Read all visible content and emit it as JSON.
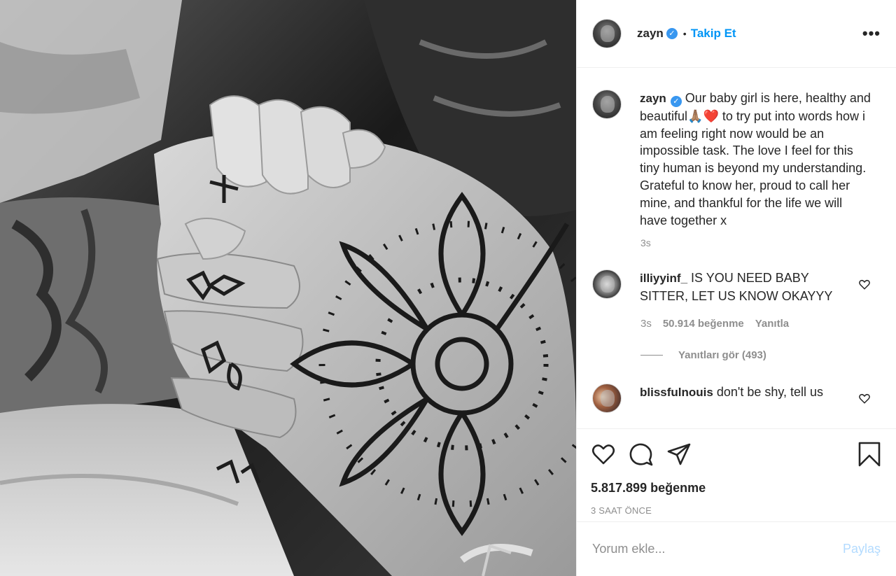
{
  "post": {
    "author": "zayn",
    "follow_label": "Takip Et",
    "separator": "•",
    "more_label": "•••"
  },
  "caption": {
    "username": "zayn",
    "text": "Our baby girl is here, healthy and beautiful🙏🏽❤️ to try put into words how i am feeling right now would be an impossible task. The love I feel for this tiny human is beyond my understanding. Grateful to know her, proud to call her mine, and thankful for the life we will have together x",
    "time": "3s"
  },
  "comments": [
    {
      "username": "illiyyinf_",
      "text": "IS YOU NEED BABY SITTER, LET US KNOW OKAYYY",
      "time": "3s",
      "likes": "50.914 beğenme",
      "reply_label": "Yanıtla",
      "view_replies": "Yanıtları gör (493)"
    },
    {
      "username": "blissfulnouis",
      "text": "don't be shy, tell us"
    }
  ],
  "actions": {
    "likes": "5.817.899 beğenme",
    "timestamp": "3 SAAT ÖNCE"
  },
  "add_comment": {
    "placeholder": "Yorum ekle...",
    "post_label": "Paylaş"
  },
  "icons": [
    "heart-icon",
    "comment-icon",
    "share-icon",
    "bookmark-icon",
    "verified-badge-icon",
    "more-icon"
  ],
  "colors": {
    "link": "#0095f6",
    "verified": "#3897f0",
    "muted": "#8e8e8e",
    "post_disabled": "#b3dbff"
  }
}
